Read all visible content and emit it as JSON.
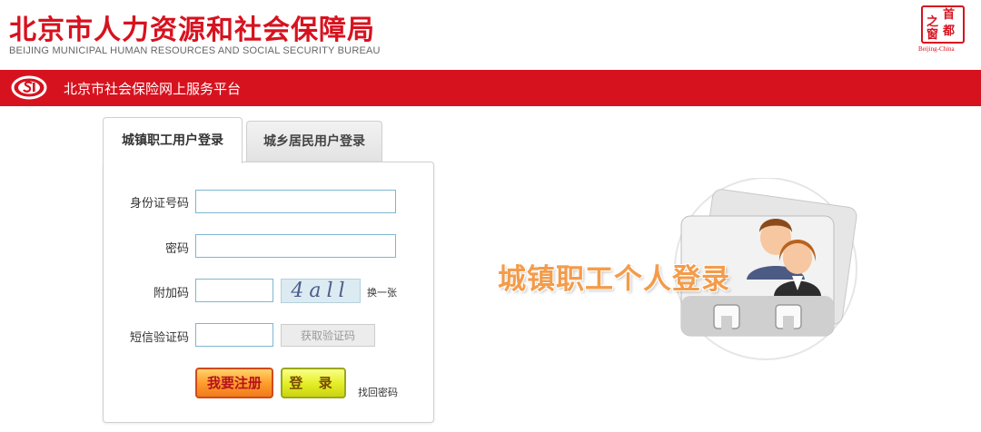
{
  "header": {
    "title_cn": "北京市人力资源和社会保障局",
    "title_en": "BEIJING MUNICIPAL HUMAN RESOURCES AND SOCIAL SECURITY BUREAU",
    "seal": {
      "chars": [
        "首",
        "之",
        "都",
        "窗"
      ],
      "caption": "Beijing-China"
    }
  },
  "bar": {
    "title": "北京市社会保险网上服务平台",
    "color": "#d7121f"
  },
  "tabs": [
    {
      "label": "城镇职工用户登录",
      "active": true
    },
    {
      "label": "城乡居民用户登录",
      "active": false
    }
  ],
  "form": {
    "id_label": "身份证号码",
    "id_value": "",
    "password_label": "密码",
    "password_value": "",
    "captcha_label": "附加码",
    "captcha_value": "",
    "captcha_text": "4all",
    "refresh_label": "换一张",
    "sms_label": "短信验证码",
    "sms_value": "",
    "sms_button": "获取验证码",
    "register_button": "我要注册",
    "login_button": "登 录",
    "forgot_link": "找回密码"
  },
  "promo": {
    "text": "城镇职工个人登录",
    "icon": "user-cards-icon"
  }
}
